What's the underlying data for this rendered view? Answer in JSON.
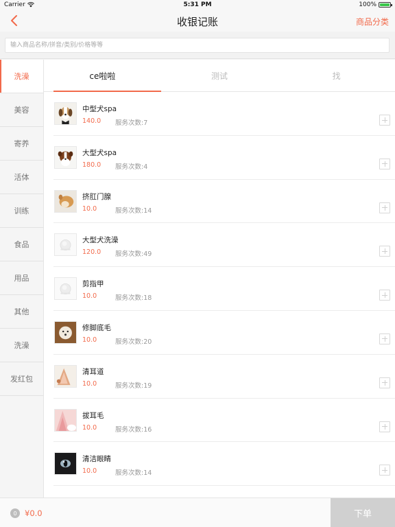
{
  "status_bar": {
    "carrier": "Carrier",
    "time": "5:31 PM",
    "battery": "100%",
    "battery_level": 1.0
  },
  "nav": {
    "back_icon": "chevron-left-icon",
    "title": "收银记账",
    "right_action": "商品分类"
  },
  "search": {
    "placeholder": "输入商品名称/拼音/类别/价格等等",
    "value": ""
  },
  "sidebar": {
    "items": [
      {
        "label": "洗澡",
        "active": true
      },
      {
        "label": "美容"
      },
      {
        "label": "寄养"
      },
      {
        "label": "活体"
      },
      {
        "label": "训练"
      },
      {
        "label": "食品"
      },
      {
        "label": "用品"
      },
      {
        "label": "其他"
      },
      {
        "label": "洗澡"
      },
      {
        "label": "发红包"
      }
    ]
  },
  "tabs": [
    {
      "label": "ce啦啦",
      "active": true
    },
    {
      "label": "测试"
    },
    {
      "label": "找"
    }
  ],
  "products": [
    {
      "name": "中型犬spa",
      "price": "140.0",
      "count": "服务次数:7",
      "thumb": "beagle-photo"
    },
    {
      "name": "大型犬spa",
      "price": "180.0",
      "count": "服务次数:4",
      "thumb": "collie-photo"
    },
    {
      "name": "挤肛门腺",
      "price": "10.0",
      "count": "服务次数:14",
      "thumb": "corgi-photo"
    },
    {
      "name": "大型犬洗澡",
      "price": "120.0",
      "count": "服务次数:49",
      "thumb": "placeholder-image"
    },
    {
      "name": "剪指甲",
      "price": "10.0",
      "count": "服务次数:18",
      "thumb": "placeholder-image"
    },
    {
      "name": "修脚底毛",
      "price": "10.0",
      "count": "服务次数:20",
      "thumb": "fluffy-dog-photo"
    },
    {
      "name": "清耳道",
      "price": "10.0",
      "count": "服务次数:19",
      "thumb": "cat-ear-photo"
    },
    {
      "name": "拔耳毛",
      "price": "10.0",
      "count": "服务次数:16",
      "thumb": "pink-ear-photo"
    },
    {
      "name": "清洁眼睛",
      "price": "10.0",
      "count": "服务次数:14",
      "thumb": "cat-eye-photo"
    }
  ],
  "bottom": {
    "cart_count": "0",
    "total": "¥0.0",
    "order_button": "下单"
  },
  "colors": {
    "accent": "#f26a4b",
    "text": "#222222",
    "muted": "#999999",
    "disabled": "#d0d0d0"
  }
}
